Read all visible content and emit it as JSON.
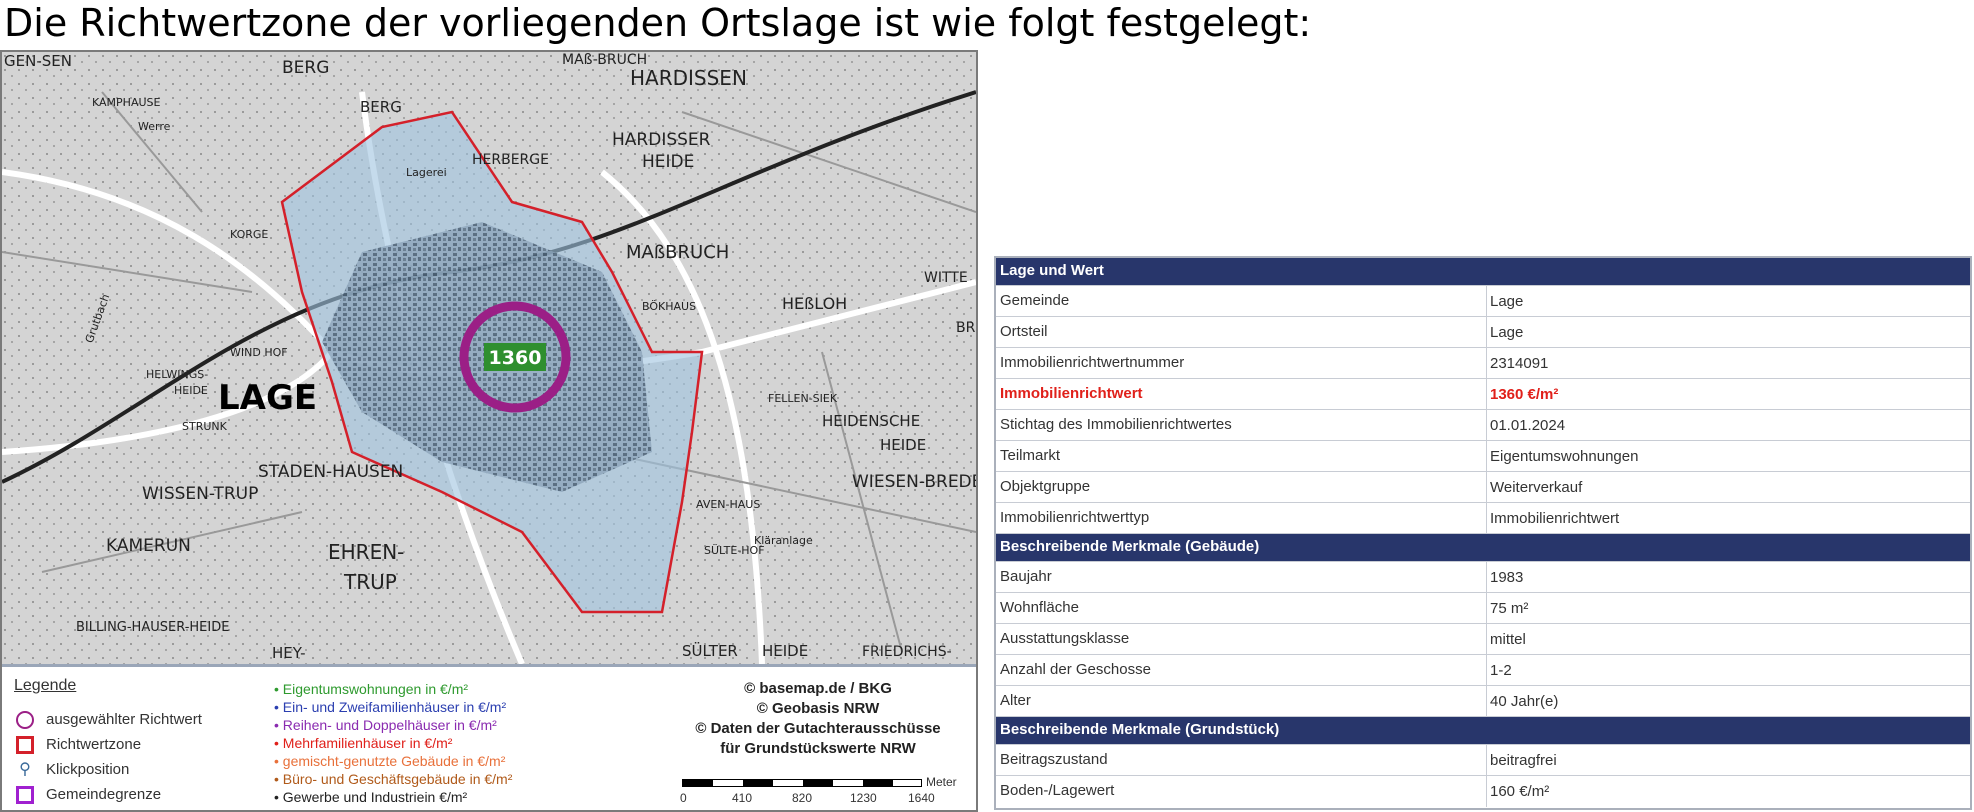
{
  "heading": "Die Richtwertzone der vorliegenden Ortslage ist wie folgt festgelegt:",
  "map": {
    "marker_value": "1360",
    "colors": {
      "zone_fill": "#9fc3e0",
      "zone_border": "#d4202a",
      "marker_ring": "#9b1f86",
      "marker_label_bg": "#2f8f2f"
    },
    "places": [
      "GEN-SEN",
      "BERG",
      "BERG",
      "MAß-BRUCH",
      "HARDISSEN",
      "KAMPHAUSE",
      "HARDISSER",
      "HEIDE",
      "HERBERGE",
      "KORGE",
      "MAßBRUCH",
      "WITTE",
      "BÖKHAUS",
      "HEßLOH",
      "BR",
      "WIND HOF",
      "HELWINGS-",
      "HEIDE",
      "LAGE",
      "FELLEN-SIEK",
      "HEIDENSCHE",
      "HEIDE",
      "STRUNK",
      "WISSEN-TRUP",
      "STADEN-HAUSEN",
      "WIESEN-BREDE",
      "AVEN-HAUS",
      "KAMERUN",
      "EHREN-",
      "TRUP",
      "SÜLTE-HOF",
      "BILLING-HAUSER-HEIDE",
      "HEY-",
      "SÜLTER",
      "HEIDE",
      "FRIEDRICHS-",
      "Lagerei",
      "Grutbach",
      "Werre",
      "Kläranlage"
    ]
  },
  "legend": {
    "title": "Legende",
    "symbols": [
      "ausgewählter Richtwert",
      "Richtwertzone",
      "Klickposition",
      "Gemeindegrenze"
    ],
    "categories": [
      {
        "label": "Eigentumswohnungen in €/m²",
        "color": "#2e9a2e"
      },
      {
        "label": "Ein- und Zweifamilienhäuser in €/m²",
        "color": "#2b3fb0"
      },
      {
        "label": "Reihen- und Doppelhäuser in €/m²",
        "color": "#8a2bb0"
      },
      {
        "label": "Mehrfamilienhäuser in €/m²",
        "color": "#e0201a"
      },
      {
        "label": "gemischt-genutzte Gebäude in €/m²",
        "color": "#e8703a"
      },
      {
        "label": "Büro- und Geschäftsgebäude in €/m²",
        "color": "#b05a1a"
      },
      {
        "label": "Gewerbe und Industriein €/m²",
        "color": "#222222"
      }
    ],
    "credits": [
      "© basemap.de / BKG",
      "© Geobasis NRW",
      "© Daten der Gutachterausschüsse",
      "für Grundstückswerte NRW"
    ],
    "scale": {
      "unit": "Meter",
      "ticks": [
        "0",
        "410",
        "820",
        "1230",
        "1640"
      ]
    }
  },
  "table": [
    {
      "section": "Lage und Wert"
    },
    {
      "key": "Gemeinde",
      "value": "Lage"
    },
    {
      "key": "Ortsteil",
      "value": "Lage"
    },
    {
      "key": "Immobilienrichtwertnummer",
      "value": "2314091"
    },
    {
      "key": "Immobilienrichtwert",
      "value": "1360 €/m²",
      "highlight": true
    },
    {
      "key": "Stichtag des Immobilienrichtwertes",
      "value": "01.01.2024"
    },
    {
      "key": "Teilmarkt",
      "value": "Eigentumswohnungen"
    },
    {
      "key": "Objektgruppe",
      "value": "Weiterverkauf"
    },
    {
      "key": "Immobilienrichtwerttyp",
      "value": "Immobilienrichtwert"
    },
    {
      "section": "Beschreibende Merkmale (Gebäude)"
    },
    {
      "key": "Baujahr",
      "value": "1983"
    },
    {
      "key": "Wohnfläche",
      "value": "75 m²"
    },
    {
      "key": "Ausstattungsklasse",
      "value": "mittel"
    },
    {
      "key": "Anzahl der Geschosse",
      "value": "1-2"
    },
    {
      "key": "Alter",
      "value": "40 Jahr(e)"
    },
    {
      "section": "Beschreibende Merkmale (Grundstück)"
    },
    {
      "key": "Beitragszustand",
      "value": "beitragfrei"
    },
    {
      "key": "Boden-/Lagewert",
      "value": "160 €/m²"
    }
  ]
}
